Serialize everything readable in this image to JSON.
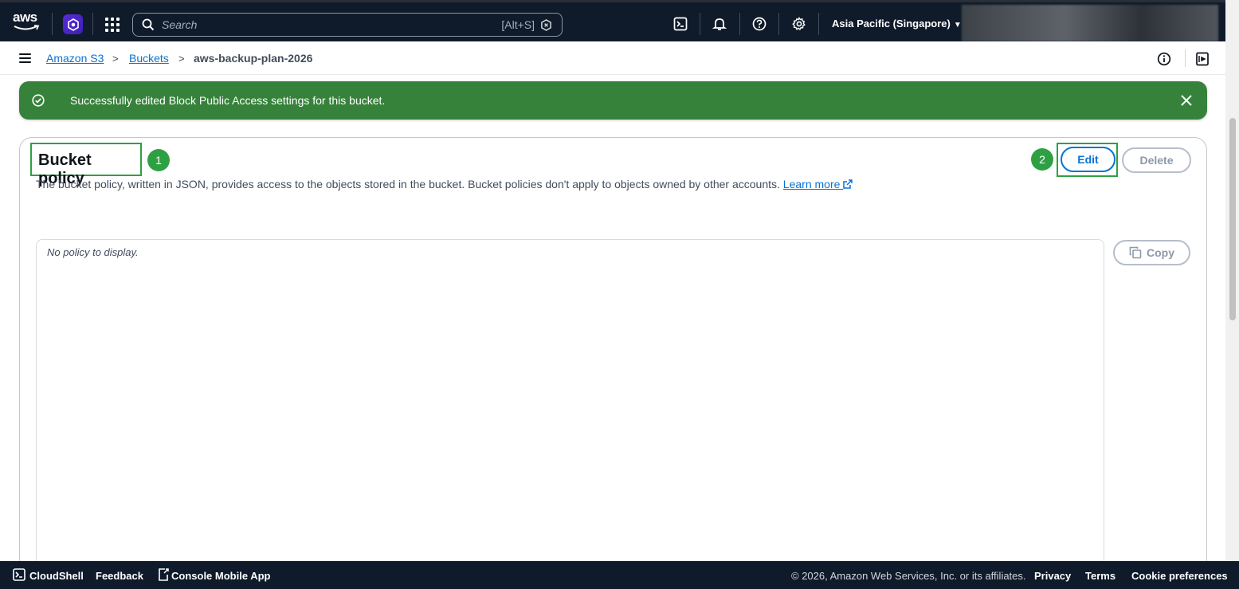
{
  "topnav": {
    "logo_text": "aws",
    "search_placeholder": "Search",
    "search_shortcut": "[Alt+S]",
    "region": "Asia Pacific (Singapore)",
    "region_caret": "▼"
  },
  "breadcrumb": {
    "items": [
      {
        "label": "Amazon S3"
      },
      {
        "label": "Buckets"
      },
      {
        "label": "aws-backup-plan-2026"
      }
    ],
    "separator": ">"
  },
  "flash": {
    "message": "Successfully edited Block Public Access settings for this bucket.",
    "color": "#37823b"
  },
  "bucket_policy": {
    "title": "Bucket policy",
    "description": "The bucket policy, written in JSON, provides access to the objects stored in the bucket. Bucket policies don't apply to objects owned by other accounts.",
    "learn_more": "Learn more",
    "edit_label": "Edit",
    "delete_label": "Delete",
    "copy_label": "Copy",
    "empty_text": "No policy to display."
  },
  "annotations": {
    "badge_1": "1",
    "badge_2": "2",
    "highlight_color": "#2ea043"
  },
  "footer": {
    "cloudshell": "CloudShell",
    "feedback": "Feedback",
    "mobile_app": "Console Mobile App",
    "copyright": "© 2026, Amazon Web Services, Inc. or its affiliates.",
    "privacy": "Privacy",
    "terms": "Terms",
    "cookies": "Cookie preferences"
  }
}
